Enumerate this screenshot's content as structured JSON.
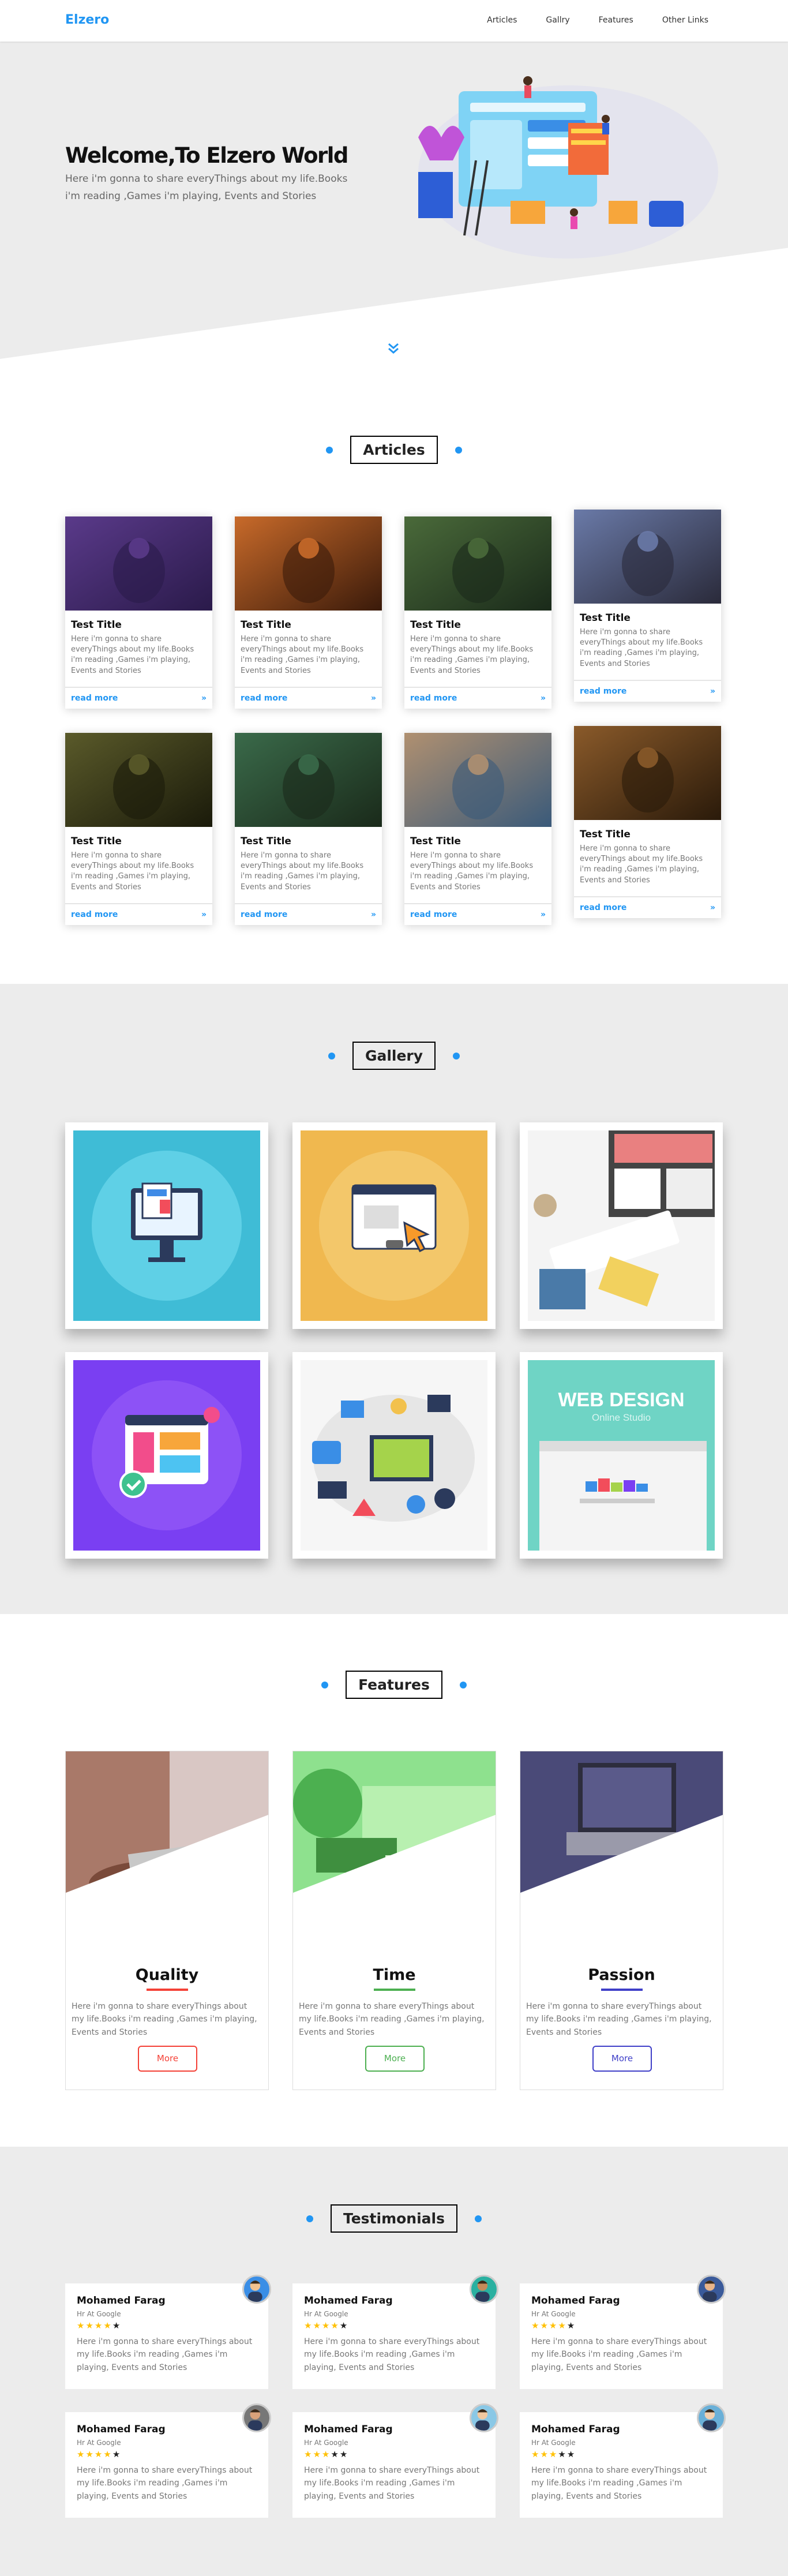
{
  "header": {
    "logo": "Elzero",
    "nav": [
      "Articles",
      "Gallry",
      "Features",
      "Other Links"
    ]
  },
  "landing": {
    "title": "Welcome,To Elzero World",
    "text": "Here i'm gonna to share everyThings about my life.Books i'm reading ,Games i'm playing, Events and Stories",
    "down_icon": "double-chevron-down-icon"
  },
  "articles": {
    "title": "Articles",
    "cards": [
      {
        "title": "Test Title",
        "text": "Here i'm gonna to share everyThings about my life.Books i'm reading ,Games i'm playing, Events and Stories",
        "link": "read more",
        "arrow": "»"
      },
      {
        "title": "Test Title",
        "text": "Here i'm gonna to share everyThings about my life.Books i'm reading ,Games i'm playing, Events and Stories",
        "link": "read more",
        "arrow": "»"
      },
      {
        "title": "Test Title",
        "text": "Here i'm gonna to share everyThings about my life.Books i'm reading ,Games i'm playing, Events and Stories",
        "link": "read more",
        "arrow": "»"
      },
      {
        "title": "Test Title",
        "text": "Here i'm gonna to share everyThings about my life.Books i'm reading ,Games i'm playing, Events and Stories",
        "link": "read more",
        "arrow": "»"
      },
      {
        "title": "Test Title",
        "text": "Here i'm gonna to share everyThings about my life.Books i'm reading ,Games i'm playing, Events and Stories",
        "link": "read more",
        "arrow": "»"
      },
      {
        "title": "Test Title",
        "text": "Here i'm gonna to share everyThings about my life.Books i'm reading ,Games i'm playing, Events and Stories",
        "link": "read more",
        "arrow": "»"
      },
      {
        "title": "Test Title",
        "text": "Here i'm gonna to share everyThings about my life.Books i'm reading ,Games i'm playing, Events and Stories",
        "link": "read more",
        "arrow": "»"
      },
      {
        "title": "Test Title",
        "text": "Here i'm gonna to share everyThings about my life.Books i'm reading ,Games i'm playing, Events and Stories",
        "link": "read more",
        "arrow": "»"
      }
    ]
  },
  "gallery": {
    "title": "Gallery",
    "banner_title": "WEB DESIGN",
    "banner_subtitle": "Online Studio"
  },
  "features": {
    "title": "Features",
    "items": [
      {
        "title": "Quality",
        "text": "Here i'm gonna to share everyThings about my life.Books i'm reading ,Games i'm playing, Events and Stories",
        "button": "More",
        "color": "#f44036"
      },
      {
        "title": "Time",
        "text": "Here i'm gonna to share everyThings about my life.Books i'm reading ,Games i'm playing, Events and Stories",
        "button": "More",
        "color": "#009688"
      },
      {
        "title": "Passion",
        "text": "Here i'm gonna to share everyThings about my life.Books i'm reading ,Games i'm playing, Events and Stories",
        "button": "More",
        "color": "#03a9f4"
      }
    ]
  },
  "testimonials": {
    "title": "Testimonials",
    "items": [
      {
        "name": "Mohamed Farag",
        "role": "Hr At Google",
        "stars": 4,
        "text": "Here i'm gonna to share everyThings about my life.Books i'm reading ,Games i'm playing, Events and Stories"
      },
      {
        "name": "Mohamed Farag",
        "role": "Hr At Google",
        "stars": 4,
        "text": "Here i'm gonna to share everyThings about my life.Books i'm reading ,Games i'm playing, Events and Stories"
      },
      {
        "name": "Mohamed Farag",
        "role": "Hr At Google",
        "stars": 4,
        "text": "Here i'm gonna to share everyThings about my life.Books i'm reading ,Games i'm playing, Events and Stories"
      },
      {
        "name": "Mohamed Farag",
        "role": "Hr At Google",
        "stars": 4,
        "text": "Here i'm gonna to share everyThings about my life.Books i'm reading ,Games i'm playing, Events and Stories"
      },
      {
        "name": "Mohamed Farag",
        "role": "Hr At Google",
        "stars": 3,
        "text": "Here i'm gonna to share everyThings about my life.Books i'm reading ,Games i'm playing, Events and Stories"
      },
      {
        "name": "Mohamed Farag",
        "role": "Hr At Google",
        "stars": 3,
        "text": "Here i'm gonna to share everyThings about my life.Books i'm reading ,Games i'm playing, Events and Stories"
      }
    ]
  },
  "colors": {
    "accent": "#2196f3",
    "section_bg": "#ececec"
  }
}
